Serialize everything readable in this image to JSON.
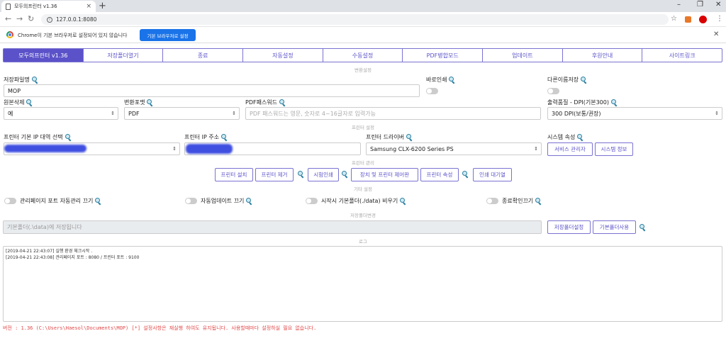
{
  "browser": {
    "tab_title": "모두의프린터 v1.36",
    "url": "127.0.0.1:8080",
    "infobar_text": "Chrome이 기본 브라우저로 설정되어 있지 않습니다",
    "infobar_button": "기본 브라우저로 설정"
  },
  "nav": {
    "tabs": [
      "모두의프린터 v1.36",
      "저장폴더열기",
      "종료",
      "자동설정",
      "수동설정",
      "PDF병합모드",
      "업데이트",
      "후원안내",
      "사이트링크"
    ]
  },
  "sections": {
    "convert": "변환설정",
    "printer": "프린터 설정",
    "printer_mgmt": "프린터 관리",
    "etc": "기타 설정",
    "save_folder": "저장폴더변경",
    "log": "로그"
  },
  "convert": {
    "filename_label": "저장파일명",
    "filename_value": "MOP",
    "direct_print_label": "바로인쇄",
    "rename_save_label": "다른이름저장",
    "delete_original_label": "원본삭제",
    "delete_original_value": "예",
    "format_label": "변환포맷",
    "format_value": "PDF",
    "pdf_password_label": "PDF패스워드",
    "pdf_password_placeholder": "PDF 패스워드는 영문, 숫자로 4~16글자로 입력가능",
    "quality_label": "출력품질 - DPI(기본300)",
    "quality_value": "300 DPI(보통/권장)"
  },
  "printer": {
    "ip_band_label": "프린터 기본 IP 대역 선택",
    "ip_label": "프린터 IP 주소",
    "driver_label": "프린터 드라이버",
    "driver_value": "Samsung CLX-6200 Series PS",
    "system_label": "시스템 속성",
    "service_manager": "서비스 관리자",
    "system_info": "시스템 정보"
  },
  "printer_mgmt": {
    "install": "프린터 설치",
    "remove": "프린터 제거",
    "test_print": "시험인쇄",
    "devices": "장치 및 프린터 제어판",
    "properties": "프린터 속성",
    "queue": "인쇄 대기열"
  },
  "etc": {
    "port_auto": "관리페이지 포트 자동관리 끄기",
    "auto_update": "자동업데이트 끄기",
    "clear_folder": "시작시 기본폴더(./data) 비우기",
    "exit_confirm": "종료확인끄기"
  },
  "save_folder": {
    "placeholder": "기본폴더(.\\data)에 저장됩니다",
    "set_button": "저장폴더설정",
    "default_button": "기본폴더사용"
  },
  "log": {
    "lines": [
      "[2019-04-21 22:43:07] 실행 환경 체크시작 .",
      "[2019-04-21 22:43:08] 관리페이지 포트 : 8080 / 프린터 포트 : 9100"
    ]
  },
  "footer": "버전 : 1.36 (C:\\Users\\Haesol\\Documents\\MOP) [*] 설정사항은 재실행 하여도 유지됩니다. 사용할때마다 설정하실 필요 없습니다."
}
